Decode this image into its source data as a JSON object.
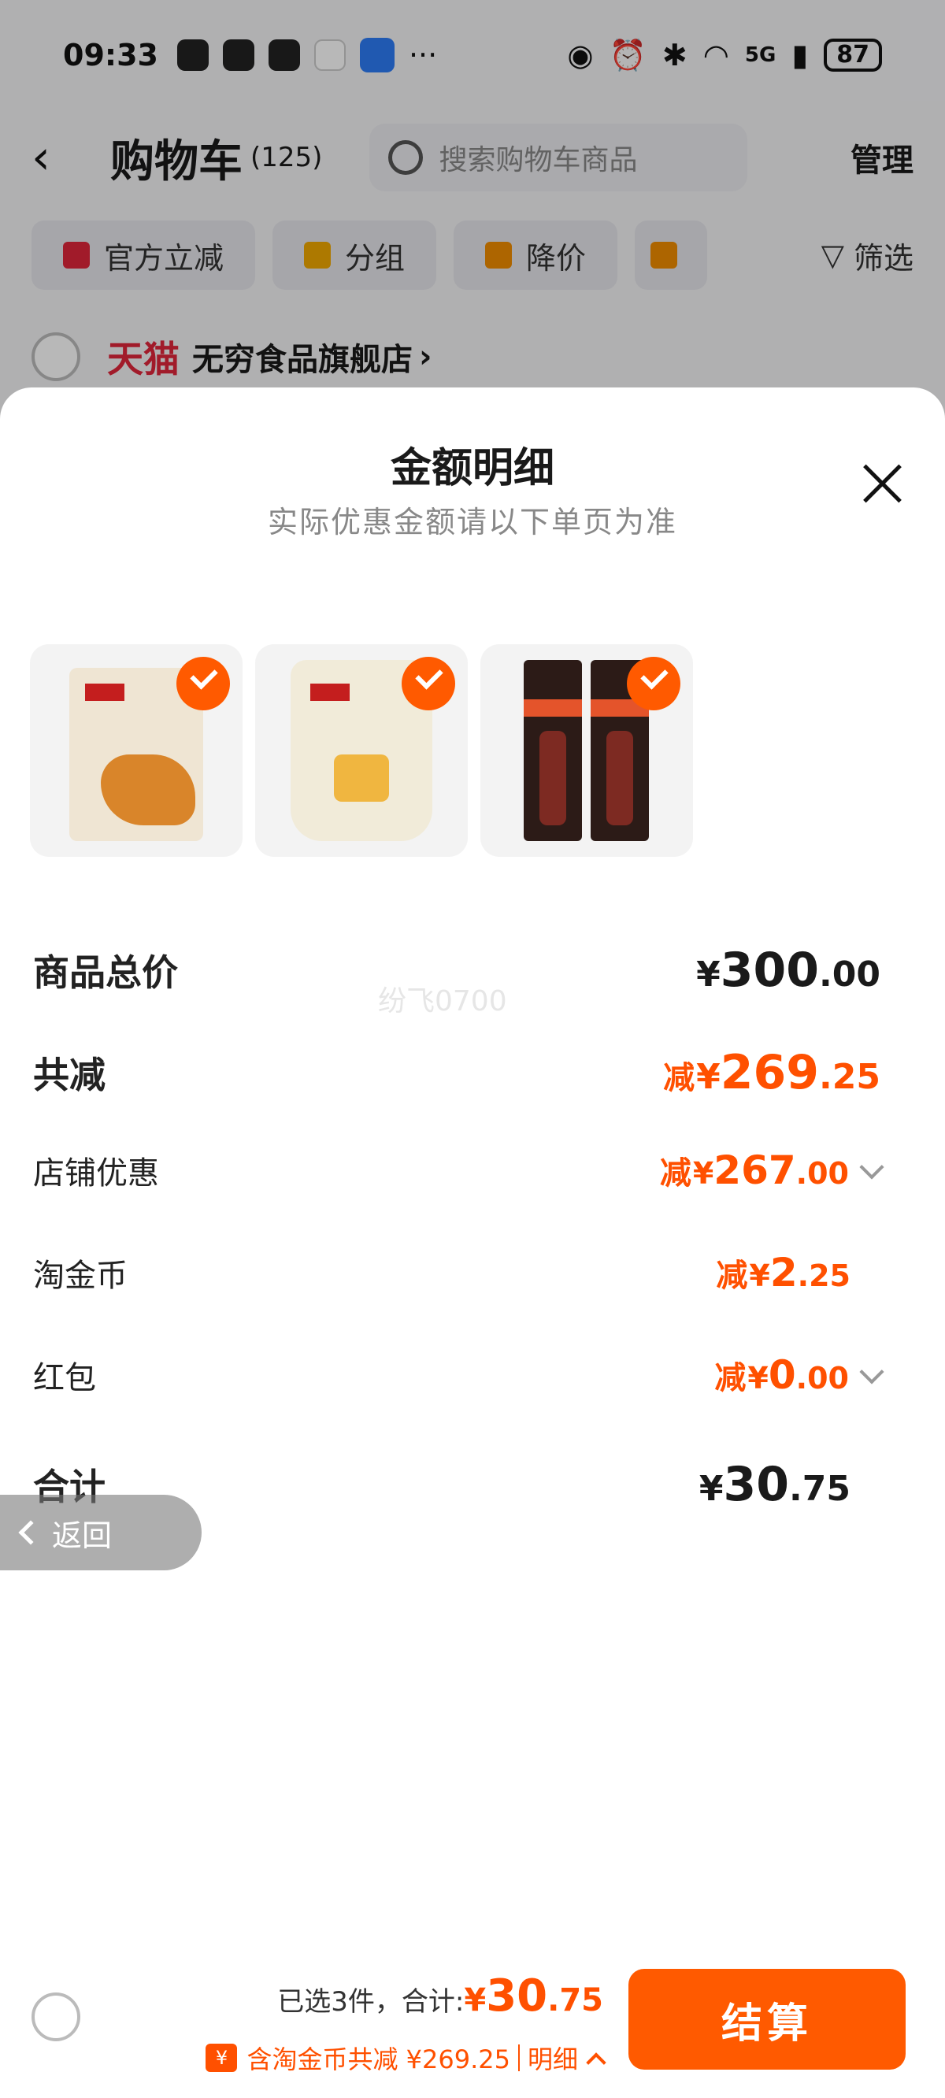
{
  "status_bar": {
    "time": "09:33",
    "signal": "5G",
    "battery": "87",
    "more": "···"
  },
  "cart": {
    "back": "‹",
    "title": "购物车",
    "count": "(125)",
    "search_placeholder": "搜索购物车商品",
    "manage": "管理",
    "chips": [
      "官方立减",
      "分组",
      "降价"
    ],
    "filter": "筛选",
    "store_brand": "天猫",
    "store_name": "无穷食品旗舰店",
    "store_arrow": "›"
  },
  "sheet": {
    "title": "金额明细",
    "subtitle": "实际优惠金额请以下单页为准",
    "watermark": "纷飞0700",
    "rows": {
      "total_price": {
        "label": "商品总价",
        "currency": "¥",
        "int": "300",
        "dec": ".00"
      },
      "total_reduce": {
        "label": "共减",
        "prefix": "减",
        "currency": "¥",
        "int": "269",
        "dec": ".25"
      },
      "store_discount": {
        "label": "店铺优惠",
        "prefix": "减",
        "currency": "¥",
        "int": "267",
        "dec": ".00"
      },
      "taojinbi": {
        "label": "淘金币",
        "prefix": "减",
        "currency": "¥",
        "int": "2",
        "dec": ".25"
      },
      "hongbao": {
        "label": "红包",
        "prefix": "减",
        "currency": "¥",
        "int": "0",
        "dec": ".00"
      },
      "sum": {
        "label": "合计",
        "currency": "¥",
        "int": "30",
        "dec": ".75"
      }
    }
  },
  "back_pill": {
    "label": "返回"
  },
  "bottom_bar": {
    "selected_text": "已选3件，合计:",
    "total_currency": "¥",
    "total_int": "30",
    "total_dec": ".75",
    "coin_icon": "¥",
    "coin_text": "含淘金币共减 ¥269.25",
    "detail": "明细",
    "checkout": "结算"
  },
  "colors": {
    "accent": "#ff5000",
    "tmall": "#e0263b"
  }
}
